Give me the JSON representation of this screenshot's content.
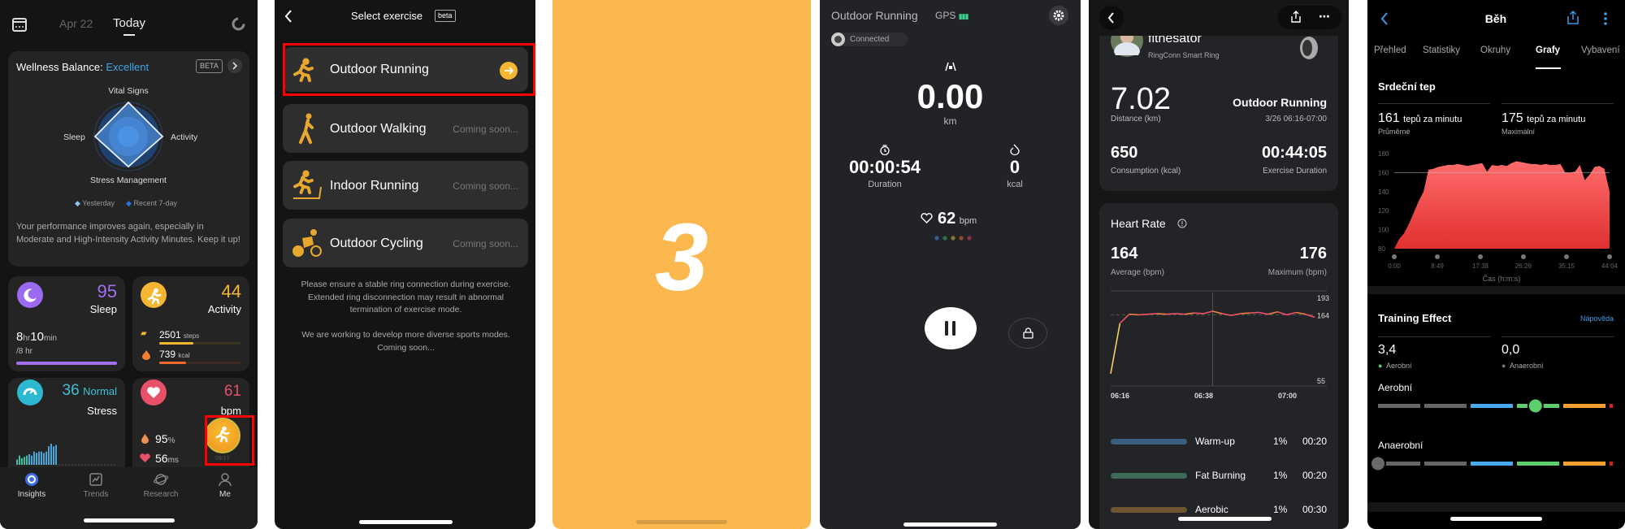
{
  "panel1": {
    "date_tabs": [
      "Apr 22",
      "Today"
    ],
    "wellness": {
      "title": "Wellness Balance:",
      "status": "Excellent",
      "badge": "BETA",
      "axes": {
        "top": "Vital Signs",
        "left": "Sleep",
        "right": "Activity",
        "bottom": "Stress Management"
      },
      "legend": [
        "Yesterday",
        "Recent 7-day"
      ],
      "message": "Your performance improves again, especially in Moderate and High-Intensity Activity Minutes. Keep it up!"
    },
    "sleep": {
      "score": "95",
      "label": "Sleep",
      "hours": "8",
      "hours_unit": "hr",
      "minutes": "10",
      "minutes_unit": "min",
      "goal": "/8 hr",
      "progress": 1.0
    },
    "activity": {
      "score": "44",
      "label": "Activity",
      "steps": "2501",
      "steps_unit": "steps",
      "steps_progress": 0.42,
      "kcal": "739",
      "kcal_unit": "kcal",
      "kcal_progress": 0.33
    },
    "stress": {
      "score": "36",
      "status": "Normal",
      "label": "Stress",
      "bars": [
        4,
        7,
        5,
        6,
        7,
        8,
        7,
        10,
        9,
        10,
        10,
        9,
        10,
        14,
        16,
        14,
        15
      ]
    },
    "heart": {
      "value": "61",
      "unit": "bpm",
      "spo2": "95",
      "spo2_unit": "%",
      "hrv": "56",
      "hrv_unit": "ms"
    },
    "exercise_fab_time": "09:17",
    "nav": [
      {
        "label": "Insights",
        "icon": "insights-icon"
      },
      {
        "label": "Trends",
        "icon": "trends-icon"
      },
      {
        "label": "Research",
        "icon": "planet-icon"
      },
      {
        "label": "Me",
        "icon": "person-icon"
      }
    ]
  },
  "panel2": {
    "title": "Select exercise",
    "badge": "beta",
    "exercises": [
      {
        "label": "Outdoor Running",
        "status": ""
      },
      {
        "label": "Outdoor Walking",
        "status": "Coming soon..."
      },
      {
        "label": "Indoor Running",
        "status": "Coming soon..."
      },
      {
        "label": "Outdoor Cycling",
        "status": "Coming soon..."
      }
    ],
    "notice": "Please ensure a stable ring connection during exercise. Extended ring disconnection may result in abnormal termination of exercise mode.",
    "notice2": "We are working to develop more diverse sports modes. Coming soon..."
  },
  "panel3": {
    "countdown": "3"
  },
  "panel4": {
    "title": "Outdoor Running",
    "gps": "GPS",
    "connection": "Connected",
    "distance": "0.00",
    "distance_unit": "km",
    "duration": "00:00:54",
    "duration_label": "Duration",
    "calories": "0",
    "calories_unit": "kcal",
    "heart_rate": "62",
    "heart_rate_unit": "bpm"
  },
  "panel5": {
    "user": "fitnesator",
    "device": "RingConn Smart Ring",
    "distance": "7.02",
    "distance_label": "Distance (km)",
    "activity": "Outdoor Running",
    "date_range": "3/26 06:16-07:00",
    "calories": "650",
    "calories_label": "Consumption (kcal)",
    "duration": "00:44:05",
    "duration_label": "Exercise Duration",
    "hr_title": "Heart Rate",
    "avg": "164",
    "avg_label": "Average (bpm)",
    "max": "176",
    "max_label": "Maximum (bpm)",
    "zones": [
      {
        "name": "Warm-up",
        "pct": "1%",
        "time": "00:20",
        "color": "#3a5e7e"
      },
      {
        "name": "Fat Burning",
        "pct": "1%",
        "time": "00:20",
        "color": "#3e6a58"
      },
      {
        "name": "Aerobic",
        "pct": "1%",
        "time": "00:30",
        "color": "#6e5530"
      }
    ]
  },
  "panel6": {
    "title": "Běh",
    "tabs": [
      "Přehled",
      "Statistiky",
      "Okruhy",
      "Grafy",
      "Vybavení"
    ],
    "active_tab": "Grafy",
    "hr_title": "Srdeční tep",
    "avg_value": "161",
    "avg_unit": "tepů za minutu",
    "avg_label": "Průměrné",
    "max_value": "175",
    "max_unit": "tepů za minutu",
    "max_label": "Maximální",
    "te_title": "Training Effect",
    "help": "Nápověda",
    "aerobic_value": "3,4",
    "aerobic_label": "Aerobní",
    "anaerobic_value": "0,0",
    "anaerobic_label": "Anaerobní",
    "aerobic_scale_label": "Aerobní",
    "anaerobic_scale_label": "Anaerobní",
    "aerobic_level": 3.4,
    "anaerobic_level": 0.0
  },
  "chart_data": [
    {
      "type": "line",
      "title": "",
      "x": [
        "06:16",
        "06:18",
        "06:20",
        "06:22",
        "06:24",
        "06:26",
        "06:28",
        "06:30",
        "06:32",
        "06:34",
        "06:36",
        "06:38",
        "06:40",
        "06:42",
        "06:44",
        "06:46",
        "06:48",
        "06:50",
        "06:52",
        "06:54",
        "06:56",
        "06:58",
        "07:00"
      ],
      "values": [
        66,
        150,
        165,
        164,
        165,
        166,
        165,
        166,
        165,
        167,
        166,
        170,
        166,
        163,
        166,
        167,
        168,
        165,
        169,
        164,
        168,
        165,
        160
      ],
      "xticks": [
        "06:16",
        "06:38",
        "07:00"
      ],
      "yticks": [
        "193",
        "164",
        "55"
      ],
      "reference_line": 164,
      "ylim": [
        55,
        193
      ]
    },
    {
      "type": "area",
      "xlabel": "Čas (h:m:s)",
      "xticks": [
        "0:00",
        "8:49",
        "17:38",
        "26:26",
        "35:15",
        "44:04"
      ],
      "yticks": [
        80,
        100,
        120,
        140,
        160,
        180
      ],
      "ylim": [
        80,
        180
      ],
      "reference_line": 160,
      "color": "#f04848",
      "x": [
        "0:00",
        "1:00",
        "2:00",
        "3:00",
        "4:00",
        "5:00",
        "6:00",
        "7:00",
        "8:00",
        "9:00",
        "10:00",
        "11:00",
        "12:00",
        "13:00",
        "14:00",
        "15:00",
        "16:00",
        "17:00",
        "18:00",
        "19:00",
        "20:00",
        "21:00",
        "22:00",
        "23:00",
        "24:00",
        "25:00",
        "26:00",
        "27:00",
        "28:00",
        "29:00",
        "30:00",
        "31:00",
        "32:00",
        "33:00",
        "34:00",
        "35:00",
        "36:00",
        "37:00",
        "38:00",
        "39:00",
        "40:00",
        "41:00",
        "42:00",
        "43:00",
        "44:04"
      ],
      "values": [
        80,
        90,
        96,
        106,
        118,
        130,
        140,
        163,
        164,
        166,
        167,
        168,
        168,
        169,
        168,
        167,
        168,
        169,
        170,
        161,
        168,
        167,
        168,
        167,
        170,
        172,
        171,
        170,
        169,
        169,
        168,
        169,
        168,
        168,
        169,
        160,
        160,
        161,
        168,
        152,
        158,
        166,
        167,
        164,
        140
      ]
    }
  ],
  "colors": {
    "ringconn_orange": "#f5b731",
    "sleep_purple": "#a070f0",
    "stress_teal": "#3ec0d8",
    "heart_pink": "#e8506a",
    "garmin_blue": "#3a9bea",
    "highlight_red": "#ff0000"
  }
}
